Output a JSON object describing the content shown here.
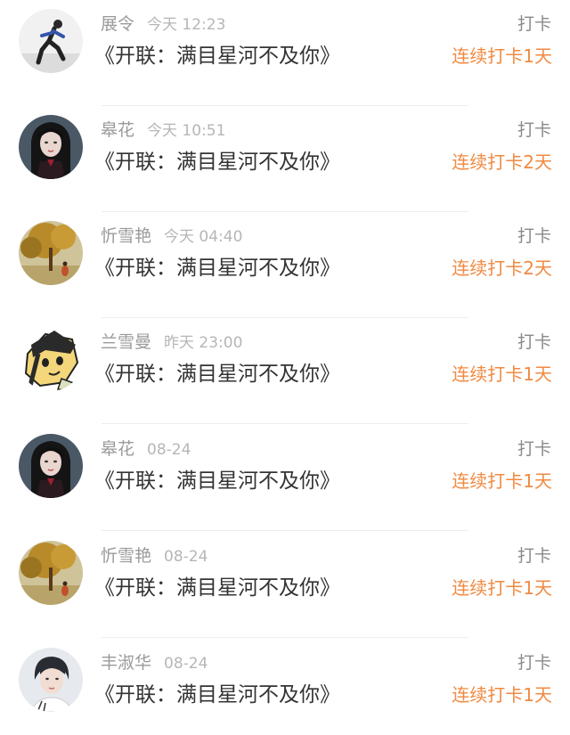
{
  "feed": {
    "items": [
      {
        "name": "展令",
        "time": "今天 12:23",
        "title": "《开联：满目星河不及你》",
        "checkin_label": "打卡",
        "streak": "连续打卡1天",
        "avatar_icon": "runner-avatar-icon"
      },
      {
        "name": "皋花",
        "time": "今天 10:51",
        "title": "《开联：满目星河不及你》",
        "checkin_label": "打卡",
        "streak": "连续打卡2天",
        "avatar_icon": "dark-hair-girl-avatar-icon"
      },
      {
        "name": "忻雪艳",
        "time": "今天 04:40",
        "title": "《开联：满目星河不及你》",
        "checkin_label": "打卡",
        "streak": "连续打卡2天",
        "avatar_icon": "autumn-tree-avatar-icon"
      },
      {
        "name": "兰雪曼",
        "time": "昨天 23:00",
        "title": "《开联：满目星河不及你》",
        "checkin_label": "打卡",
        "streak": "连续打卡1天",
        "avatar_icon": "cartoon-character-avatar-icon"
      },
      {
        "name": "皋花",
        "time": "08-24",
        "title": "《开联：满目星河不及你》",
        "checkin_label": "打卡",
        "streak": "连续打卡1天",
        "avatar_icon": "dark-hair-girl-avatar-icon"
      },
      {
        "name": "忻雪艳",
        "time": "08-24",
        "title": "《开联：满目星河不及你》",
        "checkin_label": "打卡",
        "streak": "连续打卡1天",
        "avatar_icon": "autumn-tree-avatar-icon"
      },
      {
        "name": "丰淑华",
        "time": "08-24",
        "title": "《开联：满目星河不及你》",
        "checkin_label": "打卡",
        "streak": "连续打卡1天",
        "avatar_icon": "young-man-avatar-icon"
      }
    ]
  },
  "colors": {
    "name": "#9a9a9a",
    "time": "#b6b6b6",
    "title": "#333333",
    "checkin": "#8a8a8a",
    "streak": "#f08a42",
    "divider": "#eeeeee"
  }
}
